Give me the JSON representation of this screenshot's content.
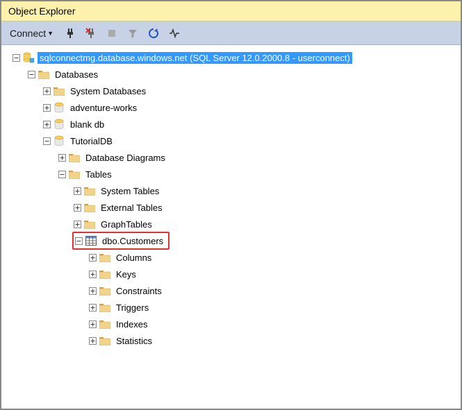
{
  "window": {
    "title": "Object Explorer"
  },
  "toolbar": {
    "connect": "Connect"
  },
  "tree": {
    "server": "sqlconnectmg.database.windows.net (SQL Server 12.0.2000.8 - userconnect)",
    "databases": "Databases",
    "system_databases": "System Databases",
    "adventure_works": "adventure-works",
    "blank_db": "blank db",
    "tutorialdb": "TutorialDB",
    "database_diagrams": "Database Diagrams",
    "tables": "Tables",
    "system_tables": "System Tables",
    "external_tables": "External Tables",
    "graph_tables": "GraphTables",
    "dbo_customers": "dbo.Customers",
    "columns": "Columns",
    "keys": "Keys",
    "constraints": "Constraints",
    "triggers": "Triggers",
    "indexes": "Indexes",
    "statistics": "Statistics"
  }
}
